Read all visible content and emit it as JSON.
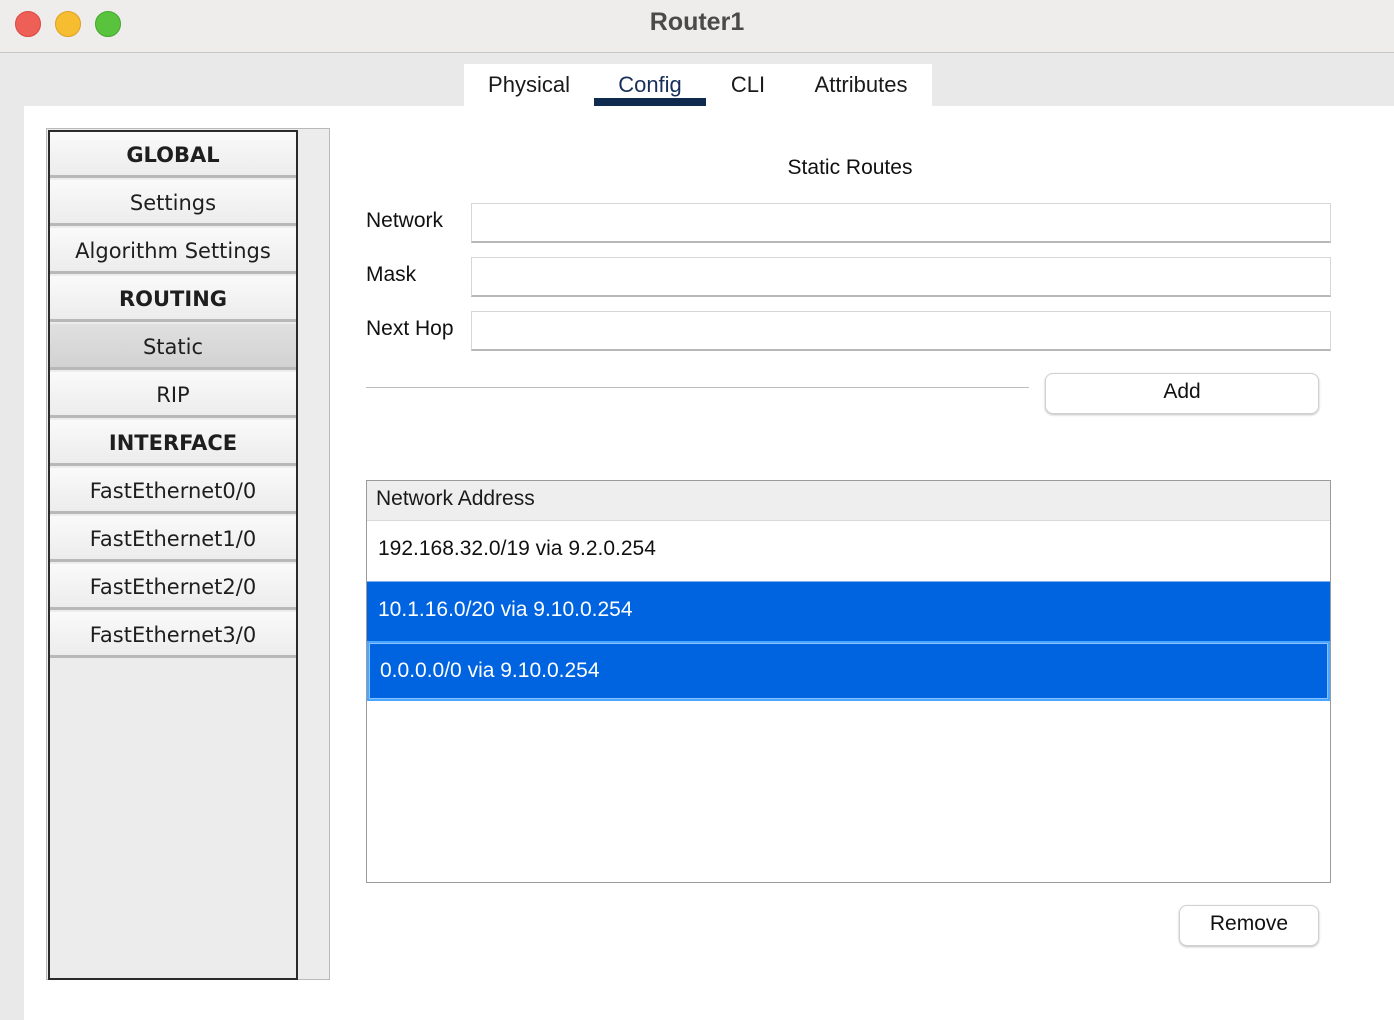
{
  "window": {
    "title": "Router1"
  },
  "tabs": [
    {
      "label": "Physical"
    },
    {
      "label": "Config"
    },
    {
      "label": "CLI"
    },
    {
      "label": "Attributes"
    }
  ],
  "active_tab": "Config",
  "sidebar": {
    "items": [
      {
        "label": "GLOBAL",
        "type": "header"
      },
      {
        "label": "Settings",
        "type": "item"
      },
      {
        "label": "Algorithm Settings",
        "type": "item"
      },
      {
        "label": "ROUTING",
        "type": "header"
      },
      {
        "label": "Static",
        "type": "item",
        "selected": true
      },
      {
        "label": "RIP",
        "type": "item"
      },
      {
        "label": "INTERFACE",
        "type": "header"
      },
      {
        "label": "FastEthernet0/0",
        "type": "item"
      },
      {
        "label": "FastEthernet1/0",
        "type": "item"
      },
      {
        "label": "FastEthernet2/0",
        "type": "item"
      },
      {
        "label": "FastEthernet3/0",
        "type": "item"
      }
    ]
  },
  "static_routes": {
    "title": "Static Routes",
    "network_label": "Network",
    "network_value": "",
    "mask_label": "Mask",
    "mask_value": "",
    "next_hop_label": "Next Hop",
    "next_hop_value": "",
    "add_label": "Add",
    "remove_label": "Remove",
    "table_header": "Network Address",
    "routes": [
      {
        "text": "192.168.32.0/19 via 9.2.0.254",
        "selected": false
      },
      {
        "text": "10.1.16.0/20 via 9.10.0.254",
        "selected": true
      },
      {
        "text": "0.0.0.0/0 via 9.10.0.254",
        "selected": true
      }
    ]
  },
  "colors": {
    "selection": "#0064e0",
    "tab_underline": "#0e2a4e",
    "close": "#ee5f57",
    "minimize": "#f7bd30",
    "zoom": "#5ac33d"
  }
}
